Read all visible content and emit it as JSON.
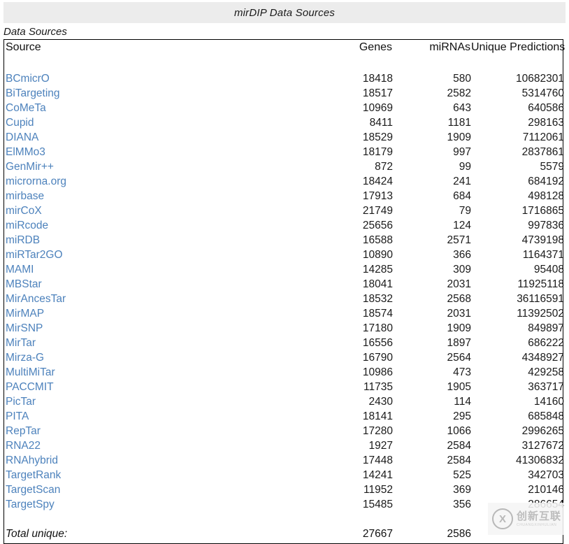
{
  "window": {
    "title": "mirDIP Data Sources"
  },
  "caption": "Data Sources",
  "table": {
    "headers": {
      "source": "Source",
      "genes": "Genes",
      "mirnas": "miRNAs",
      "predictions": "Unique Predictions"
    },
    "rows": [
      {
        "source": "BCmicrO",
        "genes": "18418",
        "mirnas": "580",
        "predictions": "10682301"
      },
      {
        "source": "BiTargeting",
        "genes": "18517",
        "mirnas": "2582",
        "predictions": "5314760"
      },
      {
        "source": "CoMeTa",
        "genes": "10969",
        "mirnas": "643",
        "predictions": "640586"
      },
      {
        "source": "Cupid",
        "genes": "8411",
        "mirnas": "1181",
        "predictions": "298163"
      },
      {
        "source": "DIANA",
        "genes": "18529",
        "mirnas": "1909",
        "predictions": "7112061"
      },
      {
        "source": "ElMMo3",
        "genes": "18179",
        "mirnas": "997",
        "predictions": "2837861"
      },
      {
        "source": "GenMir++",
        "genes": "872",
        "mirnas": "99",
        "predictions": "5579"
      },
      {
        "source": "microrna.org",
        "genes": "18424",
        "mirnas": "241",
        "predictions": "684192"
      },
      {
        "source": "mirbase",
        "genes": "17913",
        "mirnas": "684",
        "predictions": "498128"
      },
      {
        "source": "mirCoX",
        "genes": "21749",
        "mirnas": "79",
        "predictions": "1716865"
      },
      {
        "source": "miRcode",
        "genes": "25656",
        "mirnas": "124",
        "predictions": "997836"
      },
      {
        "source": "miRDB",
        "genes": "16588",
        "mirnas": "2571",
        "predictions": "4739198"
      },
      {
        "source": "miRTar2GO",
        "genes": "10890",
        "mirnas": "366",
        "predictions": "1164371"
      },
      {
        "source": "MAMI",
        "genes": "14285",
        "mirnas": "309",
        "predictions": "95408"
      },
      {
        "source": "MBStar",
        "genes": "18041",
        "mirnas": "2031",
        "predictions": "11925118"
      },
      {
        "source": "MirAncesTar",
        "genes": "18532",
        "mirnas": "2568",
        "predictions": "36116591"
      },
      {
        "source": "MirMAP",
        "genes": "18574",
        "mirnas": "2031",
        "predictions": "11392502"
      },
      {
        "source": "MirSNP",
        "genes": "17180",
        "mirnas": "1909",
        "predictions": "849897"
      },
      {
        "source": "MirTar",
        "genes": "16556",
        "mirnas": "1897",
        "predictions": "686222"
      },
      {
        "source": "Mirza-G",
        "genes": "16790",
        "mirnas": "2564",
        "predictions": "4348927"
      },
      {
        "source": "MultiMiTar",
        "genes": "10986",
        "mirnas": "473",
        "predictions": "429258"
      },
      {
        "source": "PACCMIT",
        "genes": "11735",
        "mirnas": "1905",
        "predictions": "363717"
      },
      {
        "source": "PicTar",
        "genes": "2430",
        "mirnas": "114",
        "predictions": "14160"
      },
      {
        "source": "PITA",
        "genes": "18141",
        "mirnas": "295",
        "predictions": "685848"
      },
      {
        "source": "RepTar",
        "genes": "17280",
        "mirnas": "1066",
        "predictions": "2996265"
      },
      {
        "source": "RNA22",
        "genes": "1927",
        "mirnas": "2584",
        "predictions": "3127672"
      },
      {
        "source": "RNAhybrid",
        "genes": "17448",
        "mirnas": "2584",
        "predictions": "41306832"
      },
      {
        "source": "TargetRank",
        "genes": "14241",
        "mirnas": "525",
        "predictions": "342703"
      },
      {
        "source": "TargetScan",
        "genes": "11952",
        "mirnas": "369",
        "predictions": "210146"
      },
      {
        "source": "TargetSpy",
        "genes": "15485",
        "mirnas": "356",
        "predictions": "286654"
      }
    ],
    "total": {
      "label": "Total unique:",
      "genes": "27667",
      "mirnas": "2586",
      "predictions": ""
    }
  },
  "watermark": {
    "mark": "X",
    "name": "创新互联",
    "pinyin": "CHUANGXINHULIAN"
  },
  "colors": {
    "link": "#4d82bc",
    "title_band": "#ececec",
    "border": "#000000"
  }
}
